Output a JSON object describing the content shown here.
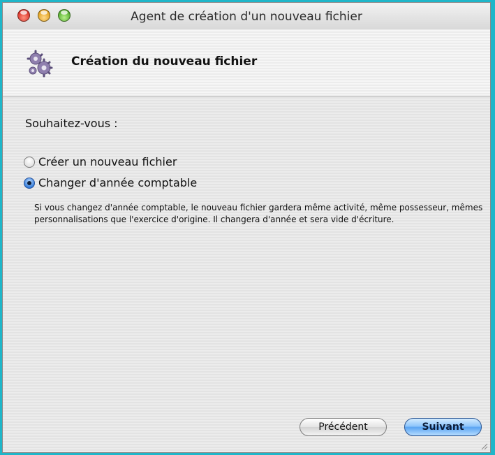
{
  "window": {
    "title": "Agent de création d'un nouveau fichier"
  },
  "header": {
    "title": "Création du nouveau fichier",
    "icon": "gears-icon"
  },
  "content": {
    "question": "Souhaitez-vous :",
    "options": [
      {
        "label": "Créer un nouveau fichier",
        "selected": false
      },
      {
        "label": "Changer d'année comptable",
        "selected": true
      }
    ],
    "description": "Si vous changez d'année comptable, le nouveau fichier gardera même activité, même possesseur, mêmes personnalisations que l'exercice d'origine. Il changera d'année et sera vide d'écriture."
  },
  "buttons": {
    "previous": "Précédent",
    "next": "Suivant"
  },
  "colors": {
    "desktop": "#1fb6c9",
    "default_button": "#5aa4f2"
  }
}
